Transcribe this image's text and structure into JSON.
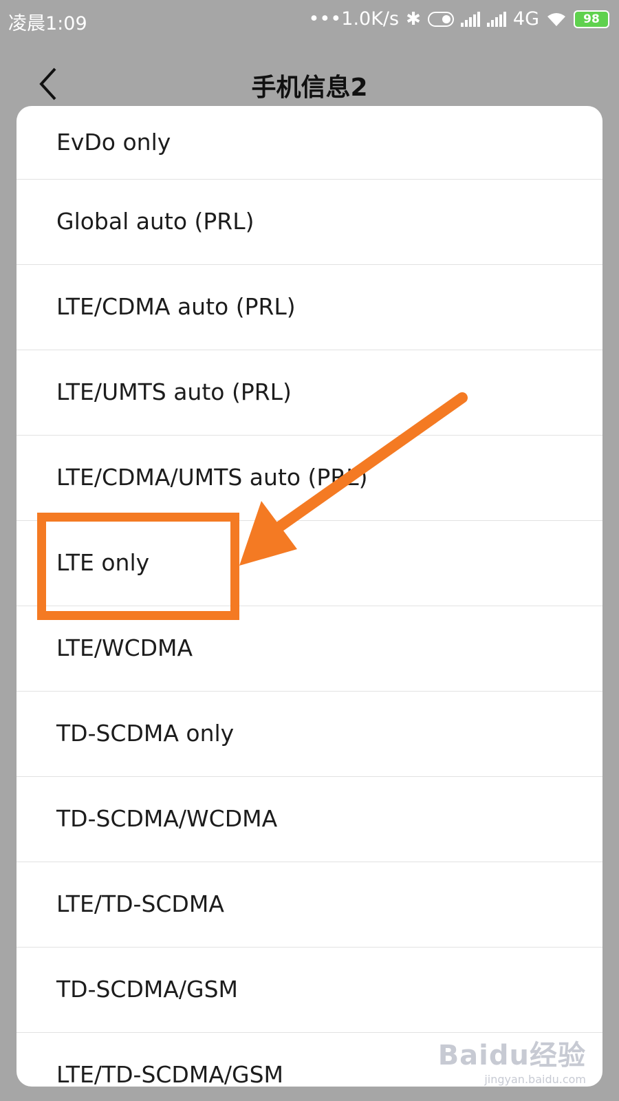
{
  "status_bar": {
    "time": "凌晨1:09",
    "speed": "•••1.0K/s",
    "network": "4G",
    "battery": "98",
    "icons": [
      "bluetooth-icon",
      "toggle-icon",
      "signal-icon",
      "signal-icon",
      "wifi-icon",
      "battery-icon"
    ]
  },
  "header": {
    "title": "手机信息2",
    "back_icon": "chevron-left-icon"
  },
  "dialog": {
    "options": [
      {
        "label": "EvDo only"
      },
      {
        "label": "Global auto (PRL)"
      },
      {
        "label": "LTE/CDMA auto (PRL)"
      },
      {
        "label": "LTE/UMTS auto (PRL)"
      },
      {
        "label": "LTE/CDMA/UMTS auto (PRL)"
      },
      {
        "label": "LTE only"
      },
      {
        "label": "LTE/WCDMA"
      },
      {
        "label": "TD-SCDMA only"
      },
      {
        "label": "TD-SCDMA/WCDMA"
      },
      {
        "label": "LTE/TD-SCDMA"
      },
      {
        "label": "TD-SCDMA/GSM"
      },
      {
        "label": "LTE/TD-SCDMA/GSM"
      }
    ]
  },
  "annotation": {
    "highlighted_option": "LTE only",
    "color": "#f47a23"
  },
  "watermark": {
    "logo": "Baidu经验",
    "domain": "jingyan.baidu.com"
  }
}
